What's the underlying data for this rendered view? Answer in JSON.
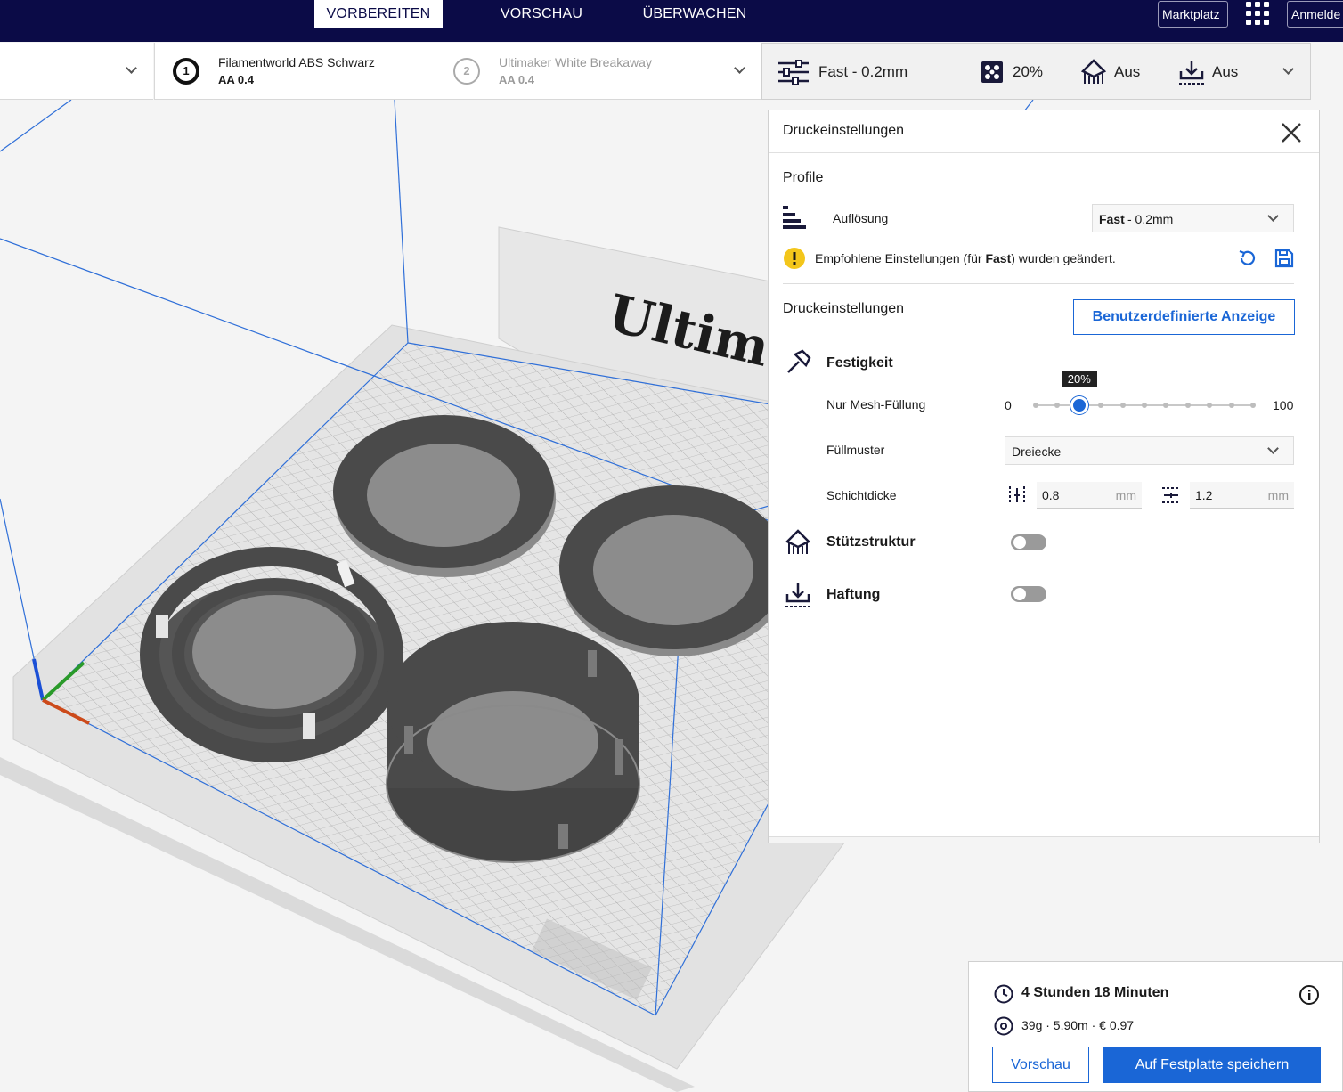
{
  "tabs": {
    "prepare": "VORBEREITEN",
    "preview": "VORSCHAU",
    "monitor": "ÜBERWACHEN"
  },
  "topbar": {
    "marketplace": "Marktplatz",
    "signin": "Anmelde"
  },
  "extruders": [
    {
      "number": "1",
      "material": "Filamentworld ABS Schwarz",
      "nozzle": "AA 0.4"
    },
    {
      "number": "2",
      "material": "Ultimaker White Breakaway",
      "nozzle": "AA 0.4"
    }
  ],
  "print_bar": {
    "profile": "Fast - 0.2mm",
    "infill": "20%",
    "support": "Aus",
    "adhesion": "Aus"
  },
  "panel": {
    "title": "Druckeinstellungen",
    "profiles_heading": "Profile",
    "resolution_label": "Auflösung",
    "resolution_bold": "Fast",
    "resolution_rest": " - 0.2mm",
    "warning_pre": "Empfohlene Einstellungen (für ",
    "warning_bold": "Fast",
    "warning_post": ") wurden geändert.",
    "settings_heading": "Druckeinstellungen",
    "custom_button": "Benutzerdefinierte Anzeige",
    "strength_heading": "Festigkeit",
    "infill_label": "Nur Mesh-Füllung",
    "infill_min": "0",
    "infill_max": "100",
    "infill_tooltip": "20%",
    "infill_value": 20,
    "pattern_label": "Füllmuster",
    "pattern_value": "Dreiecke",
    "thickness_label": "Schichtdicke",
    "wall_value": "0.8",
    "wall_unit": "mm",
    "topbottom_value": "1.2",
    "topbottom_unit": "mm",
    "support_heading": "Stützstruktur",
    "support_enabled": false,
    "adhesion_heading": "Haftung",
    "adhesion_enabled": false
  },
  "viewport": {
    "logo_text": "Ultimaker"
  },
  "job": {
    "time": "4 Stunden 18 Minuten",
    "material": "39g · 5.90m · € 0.97",
    "preview_button": "Vorschau",
    "save_button": "Auf Festplatte speichern"
  },
  "colors": {
    "header": "#0b0b47",
    "accent": "#1a66d6",
    "model": "#4a4a4a",
    "warning": "#f3c61b"
  }
}
